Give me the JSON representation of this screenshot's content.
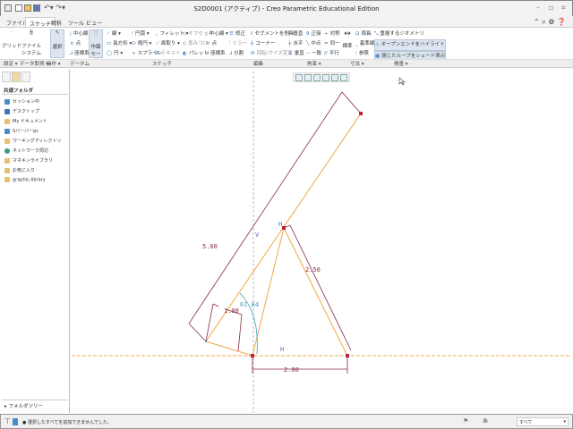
{
  "window": {
    "title": "S2D0001 (アクティブ) - Creo Parametric Educational Edition"
  },
  "tabs": [
    "ファイル▾",
    "スケッチ",
    "解析",
    "ツール",
    "ビュー"
  ],
  "ribbon": {
    "grid": "グリッド",
    "file_system": "ファイル システム",
    "select": "選択",
    "construction_mode": "作図 モード",
    "datum": [
      "中心線",
      "点",
      "座標系"
    ],
    "sketch_col1": [
      "線 ▾",
      "長方形 ▾",
      "円 ▾"
    ],
    "sketch_col2": [
      "円弧 ▾",
      "楕円 ▾",
      "スプライン"
    ],
    "sketch_col3": [
      "フィレット ▾",
      "面取り ▾",
      "テキスト"
    ],
    "sketch_col4": [
      "オフセット",
      "厚みづけ",
      "パレット"
    ],
    "sketch_col5": [
      "中心線 ▾",
      "点",
      "座標系"
    ],
    "edit": [
      "修正",
      "ミラー",
      "分割",
      "セグメントを削除",
      "コーナー",
      "回転/サイズ変更"
    ],
    "constrain": [
      "垂直",
      "水平",
      "垂直",
      "正接",
      "中点",
      "一致",
      "対称",
      "同一",
      "平行"
    ],
    "dimension": [
      "標準",
      "周長",
      "基準線",
      "参照"
    ],
    "inspect": [
      "重複するジオメトリ",
      "オープンエンドをハイライト",
      "閉じたループをシェード表示"
    ]
  },
  "groups": [
    "設定 ▾",
    "データ取得 ▾",
    "操作 ▾",
    "データム",
    "スケッチ",
    "編集",
    "拘束 ▾",
    "寸法 ▾",
    "検査 ▾"
  ],
  "left_panel": {
    "header": "共通フォルダ",
    "items": [
      "セッション中",
      "デスクトップ",
      "My ドキュメント",
      "Sバーバーpc",
      "ワーキングディレクトリ",
      "ネットワーク周辺",
      "マネキンライブラリ",
      "お気に入り",
      "graphic-library"
    ],
    "folder_tree": "▸ フォルダツリー"
  },
  "sketch": {
    "dims": [
      "5.00",
      "2.50",
      "1.00",
      "61.84",
      "2.00"
    ],
    "labels": {
      "v": "V",
      "h": "H",
      "h2": "H"
    }
  },
  "status": {
    "message": "● 選択したすべてを追加できませんでした。",
    "filter": "すべて"
  },
  "colors": {
    "geometry": "#f0a64a",
    "dimension": "#8b2a4a",
    "constraint": "#3aa0c0",
    "point": "#c0203a"
  }
}
